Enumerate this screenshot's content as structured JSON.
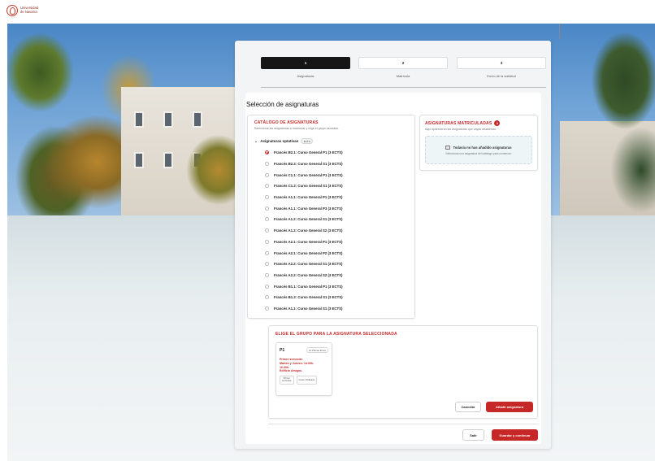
{
  "brand": {
    "logo_line1": "Universidad",
    "logo_line2": "de Navarra",
    "accent": "#c62828"
  },
  "steps": [
    {
      "number": "1",
      "label": "Asignaturas",
      "active": true
    },
    {
      "number": "2",
      "label": "Matrícula",
      "active": false
    },
    {
      "number": "3",
      "label": "Envío de la solicitud",
      "active": false
    }
  ],
  "page_title": "Selección de asignaturas",
  "catalog": {
    "title": "CATÁLOGO DE ASIGNATURAS",
    "subtitle": "Selecciona las asignaturas a matricular y elige el grupo asociado.",
    "group_title": "Asignaturas optativas",
    "group_badge": "ECTS",
    "courses": [
      "Francés B2.1: Curso General  P1 (3 ECTS)",
      "Francés B2.2: Curso General  S1 (3 ECTS)",
      "Francés C1.1: Curso General  P1 (3 ECTS)",
      "Francés C1.2: Curso General  S1 (3 ECTS)",
      "Francés A1.1: Curso General  P1 (3 ECTS)",
      "Francés A1.1: Curso General  P3 (3 ECTS)",
      "Francés A1.2: Curso General  S1 (3 ECTS)",
      "Francés A1.2: Curso General  S2 (3 ECTS)",
      "Francés A2.1: Curso General  P1 (3 ECTS)",
      "Francés A2.1: Curso General  P2 (3 ECTS)",
      "Francés A2.2: Curso General  S1 (3 ECTS)",
      "Francés A2.2: Curso General  S2 (3 ECTS)",
      "Francés B1.1: Curso General P1 (3 ECTS)",
      "Francés B1.2: Curso General  S1 (3 ECTS)",
      "Francés A1.1: Curso General S1 (3 ECTS)"
    ],
    "selected_index": 0
  },
  "enrolled": {
    "title": "ASIGNATURAS MATRICULADAS",
    "count": "0",
    "subtitle": "Aquí aparecerán las asignaturas que vayas añadiendo.",
    "empty_title": "Todavía no has añadido asignaturas",
    "empty_sub": "Selecciona una asignatura del catálogo para comenzar."
  },
  "group_section": {
    "title": "ELIGE EL GRUPO PARA LA ASIGNATURA SELECCIONADA",
    "group": {
      "code": "P1",
      "seats": "12 Plazas libres",
      "info_line1": "Primer semestre.",
      "info_line2": "Martes y Jueves: 14.00h-",
      "info_line3": "16.30h.",
      "info_line4": "Edificio Amigos.",
      "tag1_line1": "Primer",
      "tag1_line2": "semestre",
      "tag2": "Curso Ordinario"
    },
    "cancel_label": "Cancelar",
    "add_label": "Añadir asignatura"
  },
  "footer": {
    "exit_label": "Salir",
    "save_label": "Guardar y continuar"
  }
}
